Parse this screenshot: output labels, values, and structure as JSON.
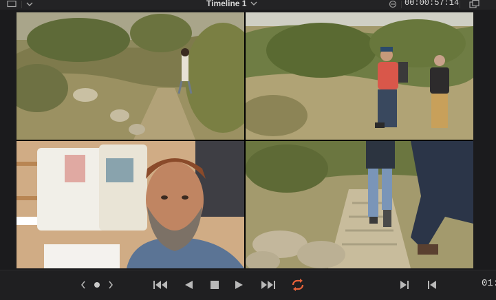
{
  "header": {
    "title": "Timeline 1",
    "timecode": "00:00:57:14",
    "left_icon": "viewer-mode-icon",
    "left_dropdown_icon": "chevron-down-icon",
    "title_dropdown_icon": "chevron-down-icon",
    "sync_icon": "clip-sync-icon",
    "right_icon": "window-layout-icon"
  },
  "viewer": {
    "tiles": [
      {
        "name": "desert-hiker-trail"
      },
      {
        "name": "two-hikers-walking"
      },
      {
        "name": "bearded-man-interview"
      },
      {
        "name": "hikers-stone-steps"
      }
    ]
  },
  "transport": {
    "prev_icon": "chevron-left-icon",
    "dot_icon": "dot-icon",
    "next_icon": "chevron-right-icon",
    "first_frame_icon": "jump-to-start-icon",
    "play_reverse_icon": "play-reverse-icon",
    "stop_icon": "stop-icon",
    "play_icon": "play-icon",
    "last_frame_icon": "jump-to-end-icon",
    "loop_icon": "loop-icon",
    "mark_in_icon": "next-marker-icon",
    "mark_out_icon": "previous-marker-icon",
    "timecode_partial": "01:",
    "loop_color": "#e8623a"
  }
}
